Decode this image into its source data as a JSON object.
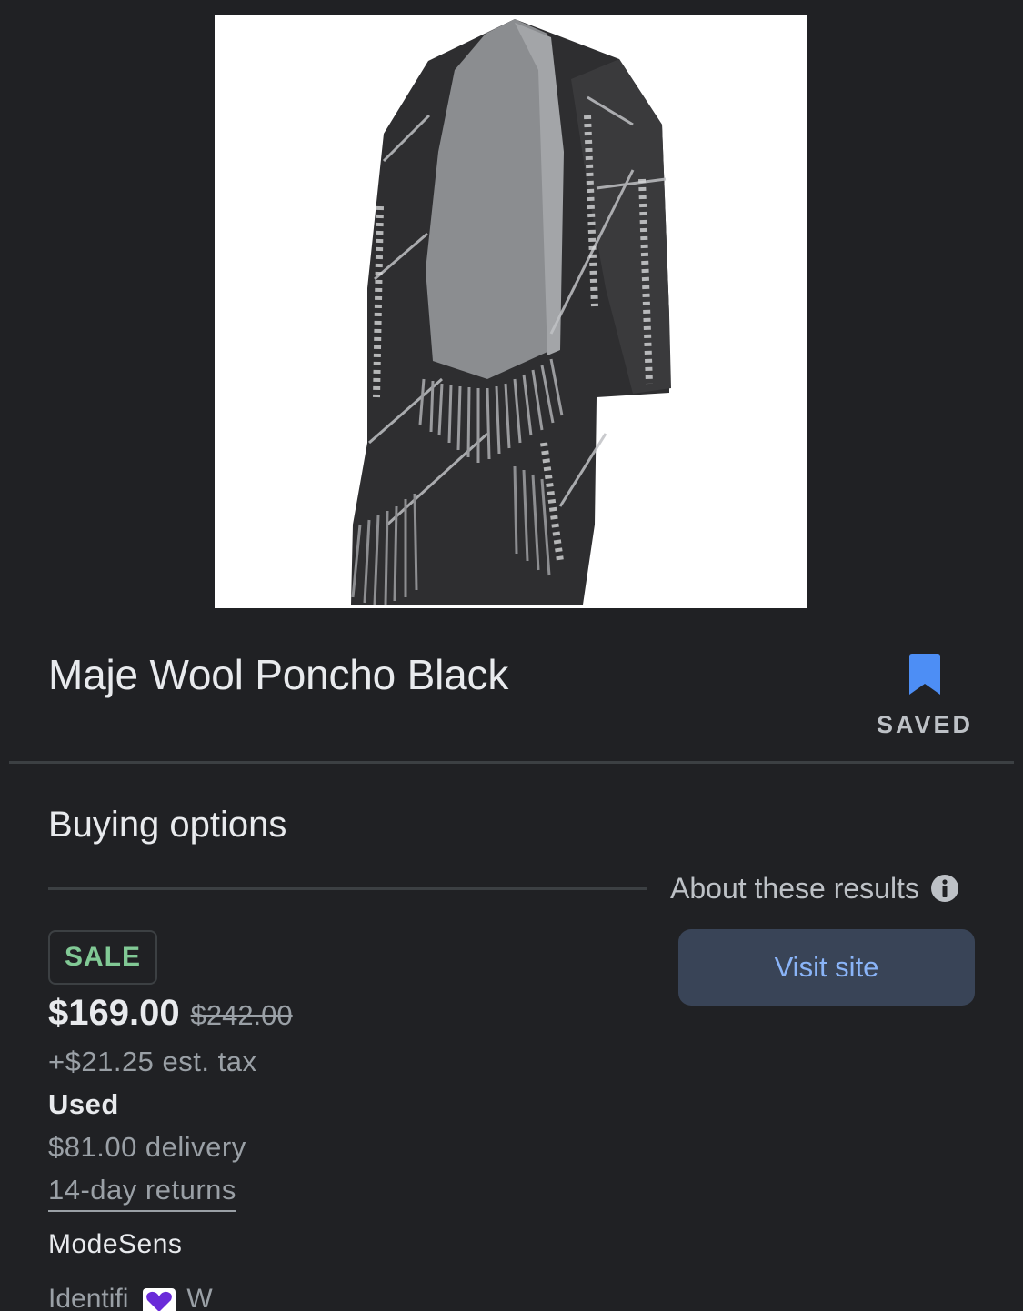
{
  "product": {
    "image_alt": "Maje Wool Poncho Black product photo",
    "title": "Maje Wool Poncho Black",
    "saved_label": "SAVED",
    "bookmark_icon": "bookmark-icon",
    "bookmark_color": "#4d8ef5"
  },
  "buying_options": {
    "title": "Buying options",
    "about_label": "About these results",
    "info_icon": "info-icon",
    "visit_label": "Visit site"
  },
  "offer": {
    "badge": "SALE",
    "price": "$169.00",
    "original_price": "$242.00",
    "tax": "+$21.25 est. tax",
    "condition": "Used",
    "delivery": "$81.00 delivery",
    "returns": "14-day returns",
    "seller": "ModeSens",
    "cutoff_left": "Identifi",
    "cutoff_right": "W"
  },
  "colors": {
    "background": "#202124",
    "sale_green": "#81c995",
    "link_blue": "#8ab4f8",
    "button_bg": "#394457"
  }
}
